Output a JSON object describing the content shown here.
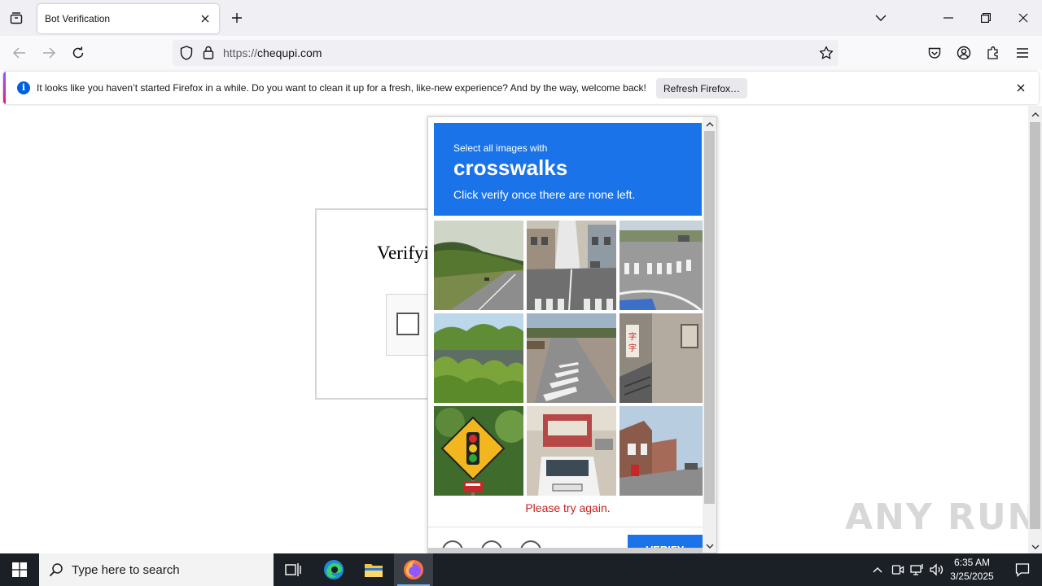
{
  "browser": {
    "tab": {
      "title": "Bot Verification"
    },
    "url": {
      "scheme": "https://",
      "host": "chequpi.com"
    },
    "notification": {
      "message": "It looks like you haven’t started Firefox in a while. Do you want to clean it up for a fresh, like-new experience? And by the way, welcome back!",
      "button_label": "Refresh Firefox…"
    }
  },
  "page": {
    "heading": "Verifyi",
    "watermark": "ANY RUN"
  },
  "captcha": {
    "instruction_small": "Select all images with",
    "keyword": "crosswalks",
    "instruction_sub": "Click verify once there are none left.",
    "error": "Please try again.",
    "verify_label": "VERIFY",
    "accent_color": "#1a73e8",
    "tiles": [
      "highway-with-trees",
      "city-street-crosswalk",
      "road-crosswalk-markings",
      "river-with-bushes",
      "road-with-crosswalk",
      "building-wall-with-sign",
      "traffic-light-sign",
      "truck-and-car",
      "street-with-houses"
    ]
  },
  "taskbar": {
    "search_placeholder": "Type here to search",
    "time": "6:35 AM",
    "date": "3/25/2025"
  }
}
